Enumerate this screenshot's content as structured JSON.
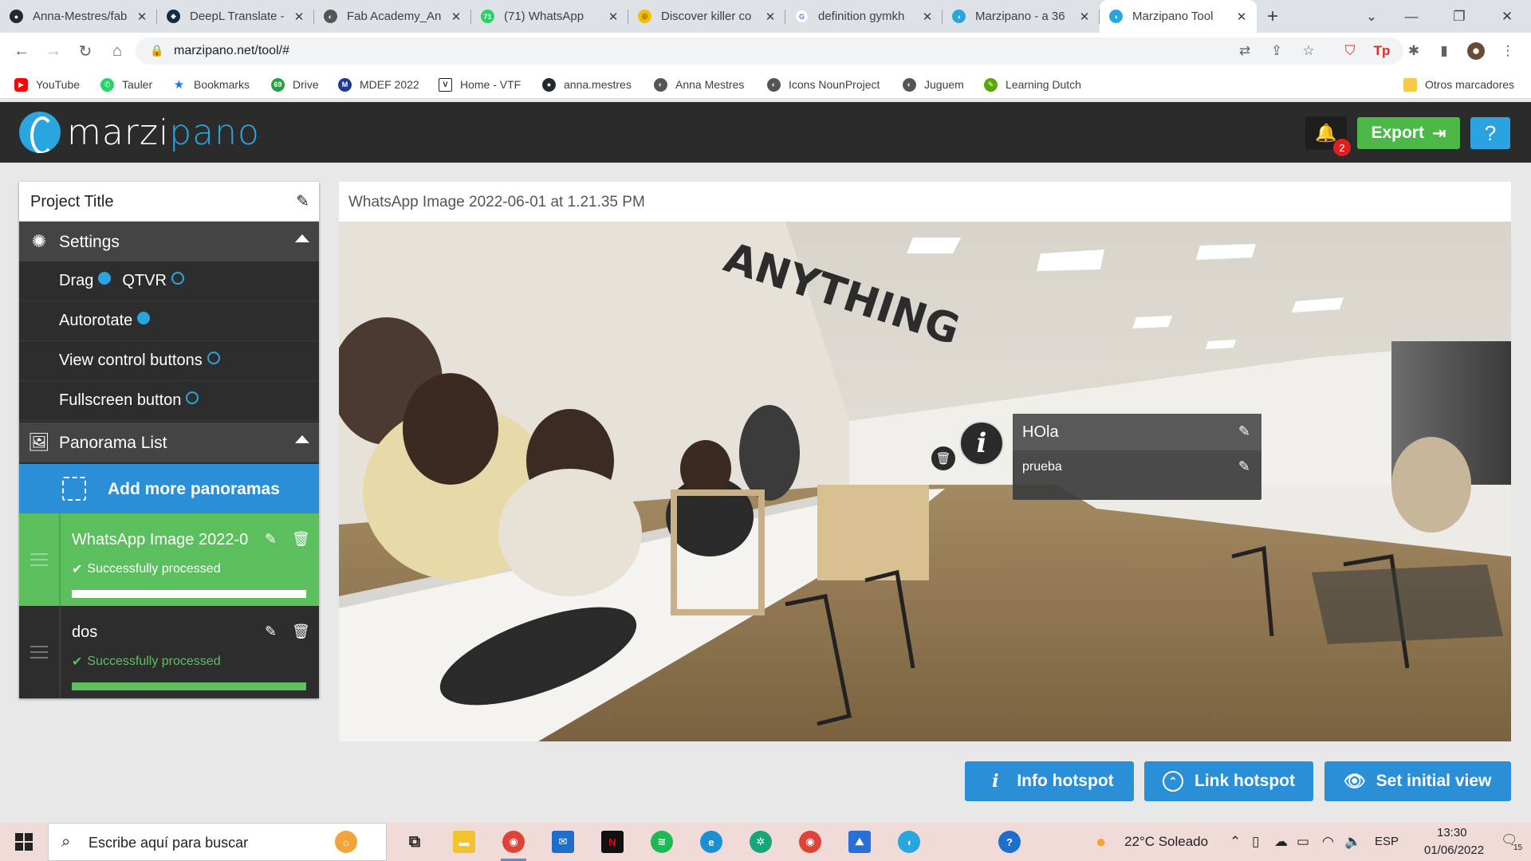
{
  "browser": {
    "tabs": [
      {
        "title": "Anna-Mestres/fab",
        "favicon": "github-icon",
        "color": "#24292e"
      },
      {
        "title": "DeepL Translate -",
        "favicon": "deepl-icon",
        "color": "#0f2b46"
      },
      {
        "title": "Fab Academy_An",
        "favicon": "globe-icon",
        "color": "#555555"
      },
      {
        "title": "(71) WhatsApp",
        "favicon": "whatsapp-icon",
        "color": "#25d366"
      },
      {
        "title": "Discover killer co",
        "favicon": "brand-icon",
        "color": "#f0c000"
      },
      {
        "title": "definition gymkh",
        "favicon": "google-icon",
        "color": "#4285f4"
      },
      {
        "title": "Marzipano - a 36",
        "favicon": "marzipano-icon",
        "color": "#29a6e0"
      },
      {
        "title": "Marzipano Tool",
        "favicon": "marzipano-icon",
        "color": "#29a6e0",
        "active": true
      }
    ],
    "url": "marzipano.net/tool/#",
    "bookmarks": [
      {
        "label": "YouTube",
        "color": "#ff0000",
        "icon": "youtube-icon"
      },
      {
        "label": "Tauler",
        "color": "#25d366",
        "icon": "whatsapp-icon"
      },
      {
        "label": "Bookmarks",
        "color": "#1a73e8",
        "icon": "star-icon"
      },
      {
        "label": "Drive",
        "color": "#25a244",
        "icon": "drive-icon"
      },
      {
        "label": "MDEF 2022",
        "color": "#1f3b8f",
        "icon": "mdef-icon"
      },
      {
        "label": "Home - VTF",
        "color": "#222222",
        "icon": "vtf-icon"
      },
      {
        "label": "anna.mestres",
        "color": "#24292e",
        "icon": "github-icon"
      },
      {
        "label": "Anna Mestres",
        "color": "#555555",
        "icon": "globe-icon"
      },
      {
        "label": "Icons NounProject",
        "color": "#555555",
        "icon": "globe-icon"
      },
      {
        "label": "Juguem",
        "color": "#555555",
        "icon": "globe-icon"
      },
      {
        "label": "Learning Dutch",
        "color": "#58a700",
        "icon": "duolingo-icon"
      }
    ],
    "other_bookmarks": "Otros marcadores"
  },
  "app": {
    "logo_left": "marzi",
    "logo_right": "pano",
    "notifications_count": "2",
    "export_label": "Export",
    "help_label": "?",
    "colors": {
      "header": "#2b2b2b",
      "accent": "#29a6e0",
      "export": "#4cb848",
      "action": "#2a8fd6"
    }
  },
  "sidebar": {
    "project_title": "Project Title",
    "settings_label": "Settings",
    "options": {
      "drag": "Drag",
      "qtvr": "QTVR",
      "autorotate": "Autorotate",
      "view_controls": "View control buttons",
      "fullscreen": "Fullscreen button"
    },
    "option_states": {
      "drag": true,
      "qtvr": false,
      "autorotate": true,
      "view_controls": false,
      "fullscreen": false
    },
    "panorama_list_label": "Panorama List",
    "add_label": "Add more panoramas",
    "panoramas": [
      {
        "name": "WhatsApp Image 2022-06-01 at 1.21.35 PM",
        "display_name": "WhatsApp Image 2022-0",
        "status": "Successfully processed",
        "selected": true,
        "progress": 1.0
      },
      {
        "name": "dos",
        "display_name": "dos",
        "status": "Successfully processed",
        "selected": false,
        "progress": 1.0
      }
    ]
  },
  "viewer": {
    "title": "WhatsApp Image 2022-06-01 at 1.21.35 PM",
    "hotspot": {
      "icon": "i",
      "title": "HOla",
      "text": "prueba"
    }
  },
  "actions": {
    "info_hotspot": "Info hotspot",
    "link_hotspot": "Link hotspot",
    "set_initial_view": "Set initial view"
  },
  "taskbar": {
    "search_placeholder": "Escribe aquí para buscar",
    "weather": "22°C  Soleado",
    "language": "ESP",
    "time": "13:30",
    "date": "01/06/2022",
    "notifications": "15"
  }
}
